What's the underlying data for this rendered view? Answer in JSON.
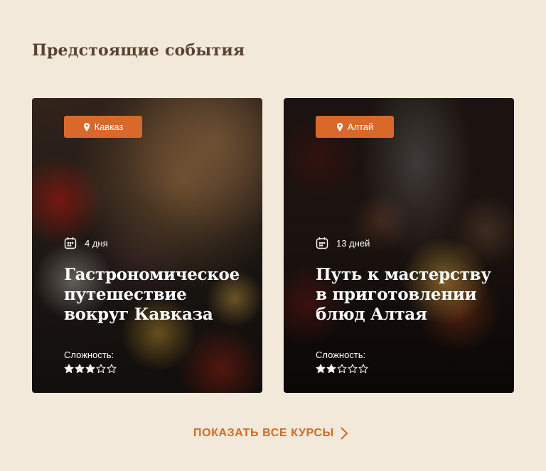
{
  "section": {
    "title": "Предстоящие события"
  },
  "events": [
    {
      "region": "Кавказ",
      "duration": "4 дня",
      "title": "Гастрономическое путешествие вокруг Кавказа",
      "difficulty_label": "Сложность:",
      "difficulty_rating": 3,
      "difficulty_max": 5
    },
    {
      "region": "Алтай",
      "duration": "13 дней",
      "title": "Путь к мастерству в приготовлении блюд Алтая",
      "difficulty_label": "Сложность:",
      "difficulty_rating": 2,
      "difficulty_max": 5
    }
  ],
  "show_all": {
    "label": "ПОКАЗАТЬ ВСЕ КУРСЫ",
    "icon": "chevron-right-icon"
  },
  "colors": {
    "background": "#f2e9da",
    "accent": "#d9692a",
    "title": "#5a4232",
    "link": "#cf6a24"
  },
  "icons": {
    "region": "pin-icon",
    "duration": "calendar-icon",
    "rating": "star-icon"
  }
}
